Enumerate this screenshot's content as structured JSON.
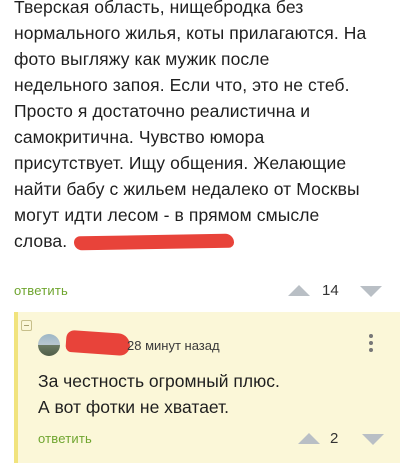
{
  "post": {
    "lines": [
      "Тверская область, нищебродка без",
      "нормального жилья, коты прилагаются. На",
      "фото выгляжу как мужик после",
      "недельного запоя. Если что, это не стеб.",
      "Просто я достаточно реалистична и",
      "самокритична. Чувство юмора",
      "присутствует. Ищу общения. Желающие",
      "найти бабу с жильем недалеко от Москвы",
      "могут идти лесом - в прямом смысле",
      "слова."
    ],
    "reply_label": "ответить",
    "rating": "14"
  },
  "comment": {
    "time": "28 минут назад",
    "lines": [
      "За честность огромный плюс.",
      "А вот фотки не хватает."
    ],
    "reply_label": "ответить",
    "rating": "2"
  },
  "colors": {
    "accent_green": "#6fa52f",
    "redaction_red": "#e8433a",
    "comment_bg": "#fbf7d8",
    "comment_bar": "#f1e37d",
    "vote_arrow": "#b9bfc5"
  },
  "icons": {
    "vote_up": "triangle-up-icon",
    "vote_down": "triangle-down-icon",
    "more": "vertical-dots-icon",
    "collapse": "minus-box-icon"
  }
}
